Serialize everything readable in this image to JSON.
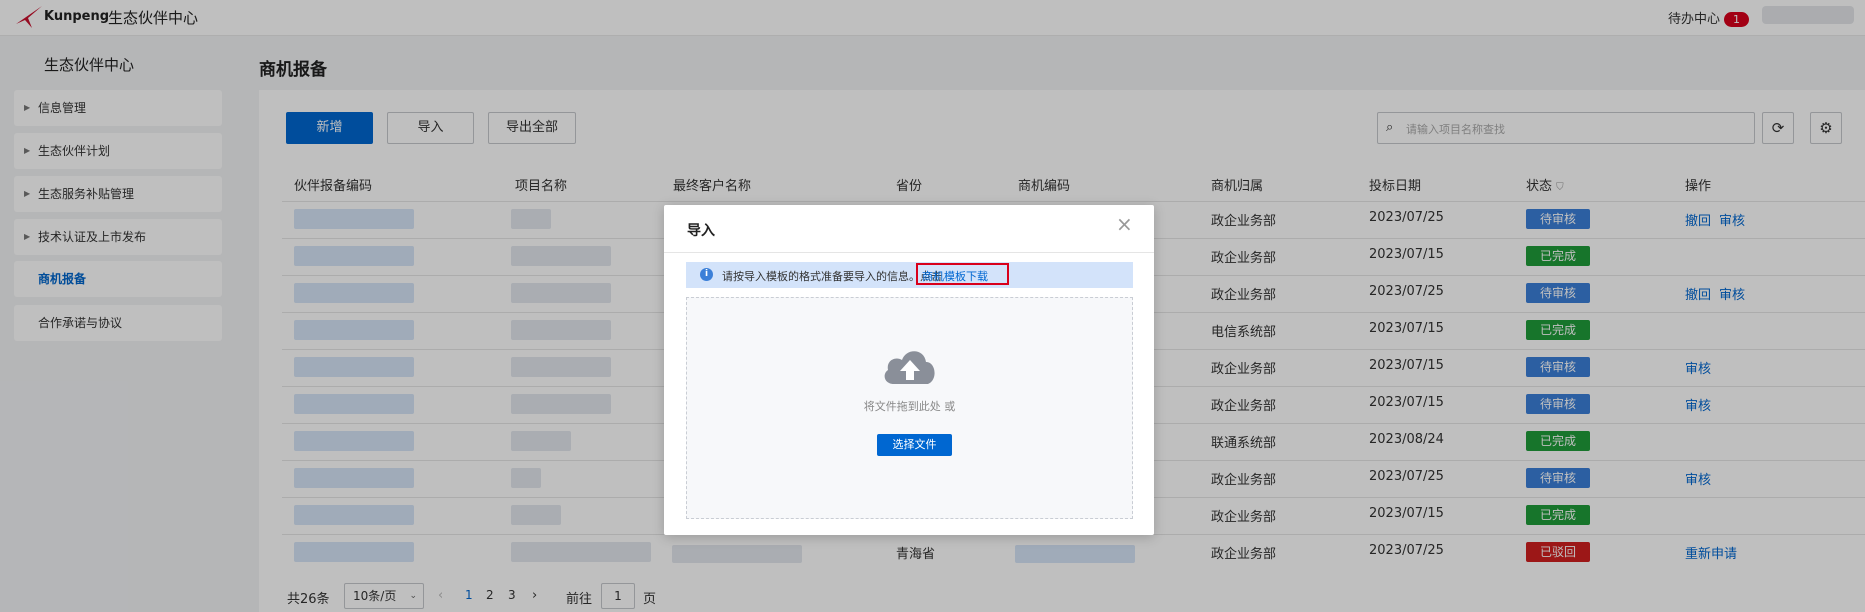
{
  "header": {
    "logo_text": "Kunpeng",
    "app_title": "生态伙伴中心",
    "todo_label": "待办中心",
    "todo_count": "1"
  },
  "sidebar": {
    "title": "生态伙伴中心",
    "items": [
      {
        "label": "信息管理"
      },
      {
        "label": "生态伙伴计划"
      },
      {
        "label": "生态服务补贴管理"
      },
      {
        "label": "技术认证及上市发布"
      },
      {
        "label": "商机报备"
      },
      {
        "label": "合作承诺与协议"
      }
    ]
  },
  "main": {
    "title": "商机报备",
    "toolbar": {
      "add_label": "新增",
      "import_label": "导入",
      "export_label": "导出全部",
      "search_placeholder": "请输入项目名称查找"
    },
    "columns": [
      "伙伴报备编码",
      "项目名称",
      "最终客户名称",
      "省份",
      "商机编码",
      "商机归属",
      "投标日期",
      "状态",
      "操作"
    ],
    "rows": [
      {
        "province": "",
        "ownership": "政企业务部",
        "date": "2023/07/25",
        "status": "待审核",
        "ops": [
          "撤回",
          "审核"
        ]
      },
      {
        "province": "",
        "ownership": "政企业务部",
        "date": "2023/07/15",
        "status": "已完成",
        "ops": []
      },
      {
        "province": "",
        "ownership": "政企业务部",
        "date": "2023/07/25",
        "status": "待审核",
        "ops": [
          "撤回",
          "审核"
        ]
      },
      {
        "province": "",
        "ownership": "电信系统部",
        "date": "2023/07/15",
        "status": "已完成",
        "ops": []
      },
      {
        "province": "",
        "ownership": "政企业务部",
        "date": "2023/07/15",
        "status": "待审核",
        "ops": [
          "审核"
        ]
      },
      {
        "province": "",
        "ownership": "政企业务部",
        "date": "2023/07/15",
        "status": "待审核",
        "ops": [
          "审核"
        ]
      },
      {
        "province": "",
        "ownership": "联通系统部",
        "date": "2023/08/24",
        "status": "已完成",
        "ops": []
      },
      {
        "province": "",
        "ownership": "政企业务部",
        "date": "2023/07/25",
        "status": "待审核",
        "ops": [
          "审核"
        ]
      },
      {
        "province": "",
        "ownership": "政企业务部",
        "date": "2023/07/15",
        "status": "已完成",
        "ops": []
      },
      {
        "province": "青海省",
        "ownership": "政企业务部",
        "date": "2023/07/25",
        "status": "已驳回",
        "ops": [
          "重新申请"
        ]
      }
    ],
    "pagination": {
      "total": "共26条",
      "page_size": "10条/页",
      "pages": [
        "1",
        "2",
        "3"
      ],
      "goto_label": "前往",
      "goto_value": "1",
      "page_unit": "页"
    }
  },
  "modal": {
    "title": "导入",
    "tip_text": "请按导入模板的格式准备要导入的信息。点击",
    "tip_link": "商机模板下载",
    "upload_hint": "将文件拖到此处 或",
    "upload_button": "选择文件"
  },
  "colors": {
    "primary": "#0067d1",
    "pending": "#3b7fd8",
    "done": "#1f9d3a",
    "rejected": "#d11f1f",
    "badge": "#d9001b"
  }
}
